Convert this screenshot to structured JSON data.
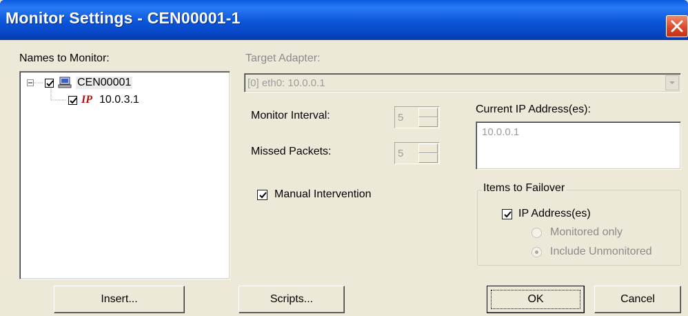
{
  "window": {
    "title": "Monitor Settings - CEN00001-1"
  },
  "left": {
    "label": "Names to Monitor:",
    "tree": [
      {
        "label": "CEN00001",
        "checked": true,
        "icon": "computer-icon"
      },
      {
        "label": "10.0.3.1",
        "checked": true,
        "icon": "ip-icon",
        "icon_text": "IP"
      }
    ]
  },
  "target": {
    "label": "Target Adapter:",
    "value": "[0] eth0: 10.0.0.1"
  },
  "monitor_interval": {
    "label": "Monitor Interval:",
    "value": "5"
  },
  "missed_packets": {
    "label": "Missed Packets:",
    "value": "5"
  },
  "current_ip": {
    "label": "Current IP Address(es):",
    "value": "10.0.0.1"
  },
  "manual_intervention": {
    "label": "Manual Intervention",
    "checked": true
  },
  "failover": {
    "title": "Items to Failover",
    "ip_addresses": {
      "label": "IP Address(es)",
      "checked": true
    },
    "options": [
      {
        "label": "Monitored only",
        "selected": false
      },
      {
        "label": "Include Unmonitored",
        "selected": true
      }
    ]
  },
  "buttons": {
    "insert": "Insert...",
    "scripts": "Scripts...",
    "ok": "OK",
    "cancel": "Cancel"
  },
  "colors": {
    "titlebar": "#0a55d8",
    "close": "#d9452a",
    "dialog_bg": "#ece9d8",
    "disabled_text": "#8b8b8b"
  }
}
